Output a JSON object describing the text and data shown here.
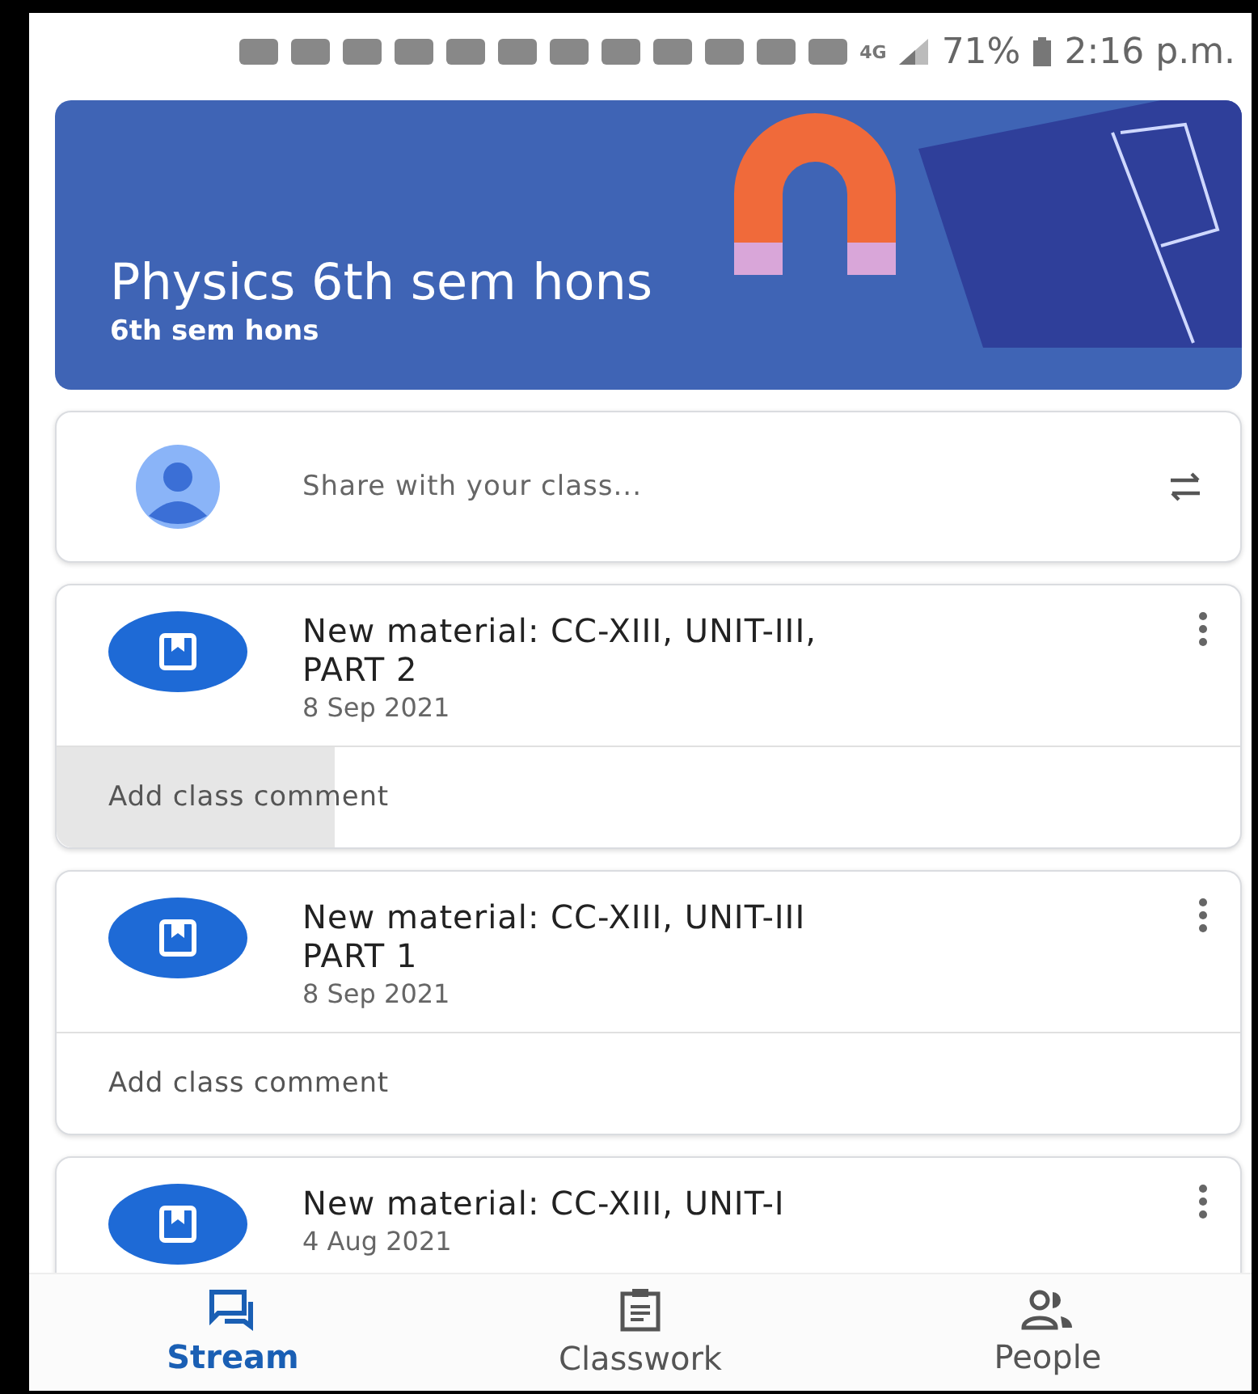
{
  "status_bar": {
    "network": "4G",
    "battery": "71%",
    "time": "2:16 p.m."
  },
  "banner": {
    "title": "Physics 6th sem hons",
    "subtitle": "6th sem hons"
  },
  "share": {
    "placeholder": "Share with your class..."
  },
  "posts": [
    {
      "title": "New material: CC-XIII, UNIT-III, PART 2",
      "date": "8 Sep 2021",
      "comment": "Add class comment",
      "pressed": true
    },
    {
      "title": "New material: CC-XIII, UNIT-III PART 1",
      "date": "8 Sep 2021",
      "comment": "Add class comment",
      "pressed": false
    },
    {
      "title": "New material: CC-XIII, UNIT-I",
      "date": "4 Aug 2021"
    }
  ],
  "nav": [
    {
      "label": "Stream",
      "kind": "stream",
      "selected": true
    },
    {
      "label": "Classwork",
      "kind": "classwork",
      "selected": false
    },
    {
      "label": "People",
      "kind": "people",
      "selected": false
    }
  ]
}
